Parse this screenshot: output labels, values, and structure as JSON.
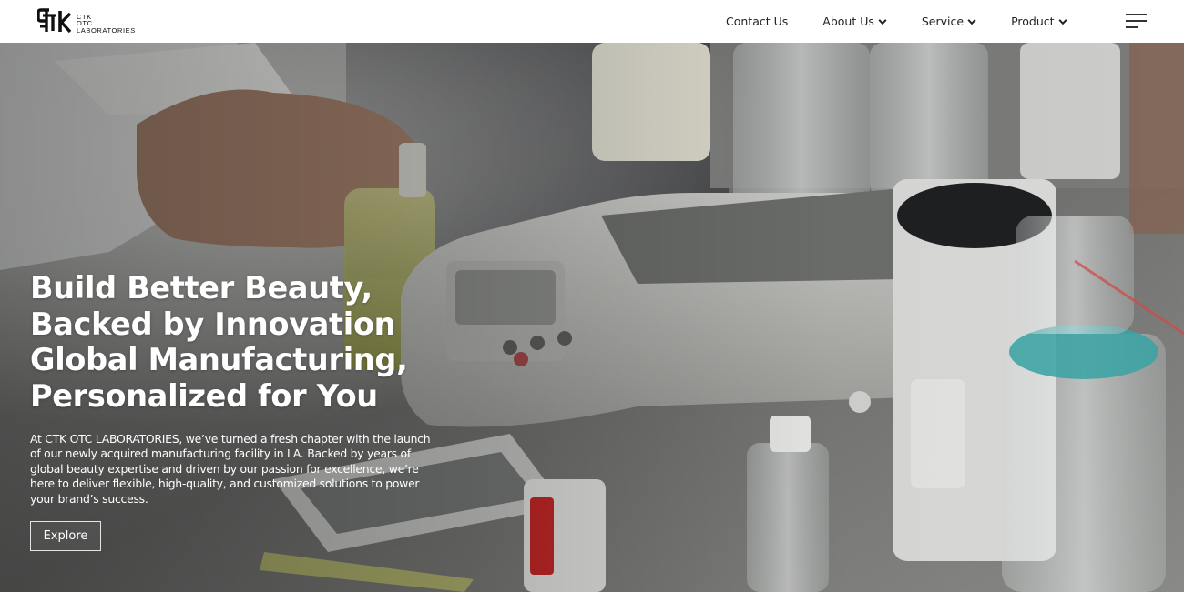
{
  "header": {
    "logo": {
      "mark_text": "CTK",
      "lines": [
        "CTK",
        "OTC",
        "LABORATORIES"
      ]
    },
    "nav": [
      {
        "label": "Contact Us",
        "has_dropdown": false
      },
      {
        "label": "About Us",
        "has_dropdown": true
      },
      {
        "label": "Service",
        "has_dropdown": true
      },
      {
        "label": "Product",
        "has_dropdown": true
      }
    ],
    "menu_icon": "hamburger-menu-icon"
  },
  "hero": {
    "title_lines": [
      "Build Better Beauty,",
      "Backed by Innovation",
      "Global Manufacturing,",
      "Personalized for You"
    ],
    "description": "At CTK OTC LABORATORIES, we’ve turned a fresh chapter with the launch of our newly acquired manufacturing facility in LA. Backed by years of global beauty expertise and driven by our passion for excellence, we’re here to deliver flexible, high-quality, and customized solutions to power your brand’s success.",
    "button_label": "Explore"
  },
  "colors": {
    "header_bg": "#ffffff",
    "nav_text": "#222222",
    "hero_text": "#ffffff"
  }
}
